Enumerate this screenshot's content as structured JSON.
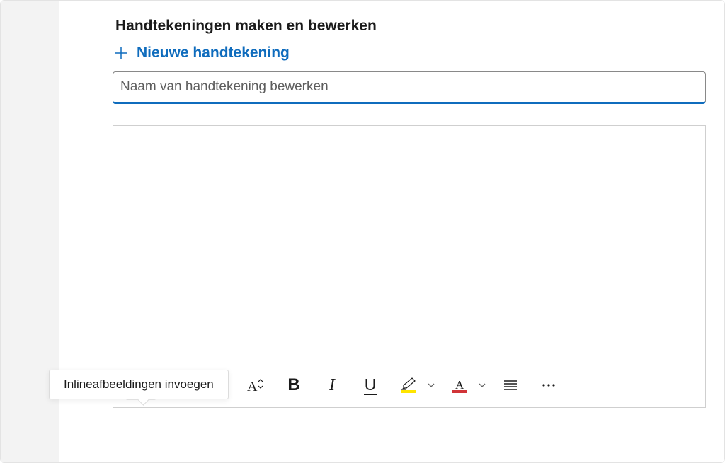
{
  "section_title": "Handtekeningen maken en bewerken",
  "new_signature_label": "Nieuwe handtekening",
  "name_input": {
    "placeholder": "Naam van handtekening bewerken",
    "value": ""
  },
  "tooltip_text": "Inlineafbeeldingen invoegen",
  "toolbar": {
    "items": [
      {
        "id": "insert-image",
        "name_attr": "image-icon",
        "active": true
      },
      {
        "id": "format-painter",
        "name_attr": "format-painter-icon"
      },
      {
        "id": "font",
        "name_attr": "font-icon"
      },
      {
        "id": "font-size",
        "name_attr": "font-size-icon"
      },
      {
        "id": "bold",
        "name_attr": "bold-icon"
      },
      {
        "id": "italic",
        "name_attr": "italic-icon"
      },
      {
        "id": "underline",
        "name_attr": "underline-icon"
      },
      {
        "id": "highlight",
        "name_attr": "highlighter-icon",
        "has_chevron": true
      },
      {
        "id": "font-color",
        "name_attr": "font-color-icon",
        "has_chevron": true
      },
      {
        "id": "list",
        "name_attr": "bullet-list-icon"
      },
      {
        "id": "overflow",
        "name_attr": "ellipsis-icon"
      }
    ]
  },
  "colors": {
    "accent": "#0f6cbd",
    "highlight": "#ffe500",
    "font_color_sample": "#d13438"
  }
}
